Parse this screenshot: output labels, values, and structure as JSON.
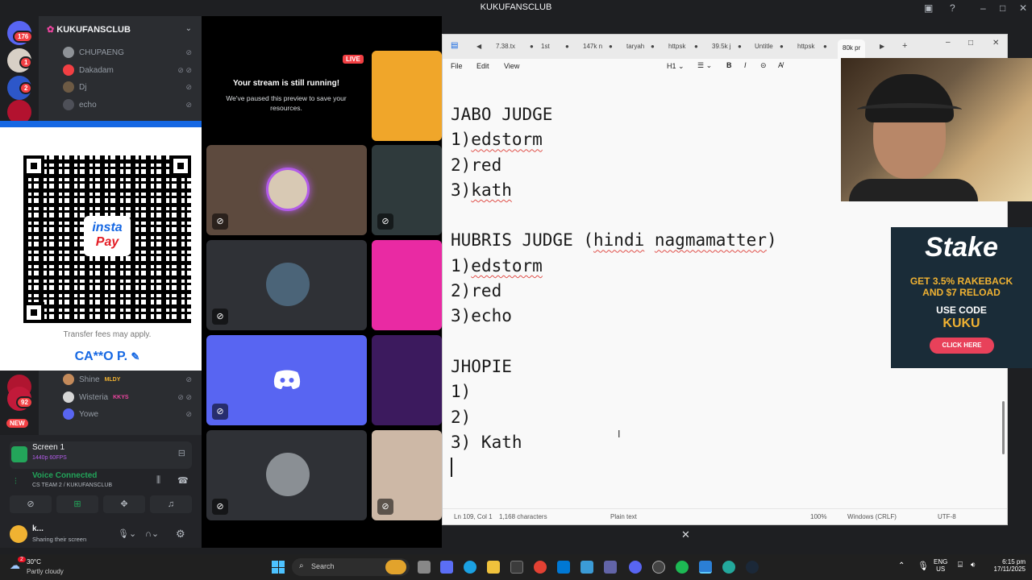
{
  "window_title": "KUKUFANSCLUB",
  "rail": {
    "badges": [
      "176",
      "1",
      "2",
      "92"
    ],
    "new_label": "NEW"
  },
  "channels": {
    "server_name": "KUKUFANSCLUB",
    "members_top": [
      "CHUPAENG",
      "Dakadam",
      "Dj",
      "echo"
    ],
    "members_bottom": [
      {
        "name": "Shine",
        "tag": "MLDY"
      },
      {
        "name": "Wisteria",
        "tag": "KKYS"
      },
      {
        "name": "Yowe",
        "tag": ""
      }
    ]
  },
  "qr_overlay": {
    "logo_top": "insta",
    "logo_bottom": "Pay",
    "fees_note": "Transfer fees may apply.",
    "account_name": "CA**O P."
  },
  "stream": {
    "live_badge": "LIVE",
    "paused_title": "Your stream is still running!",
    "paused_body": "We've paused this preview to save your resources."
  },
  "notepad": {
    "tabs": [
      "7.38.tx",
      "1st",
      "147k n",
      "taryah",
      "httpsk",
      "39.5k j",
      "Untitle",
      "httpsk"
    ],
    "active_tab": "80k pr",
    "menu": {
      "file": "File",
      "edit": "Edit",
      "view": "View",
      "heading": "H1"
    },
    "lines": {
      "l1": "JABO JUDGE",
      "l2a": "1)",
      "l2b": "edstorm",
      "l3": "2)red",
      "l4a": "3)",
      "l4b": "kath",
      "l5a": "HUBRIS JUDGE (",
      "l5b": "hindi",
      "l5c": " ",
      "l5d": "nagmamatter",
      "l5e": ")",
      "l6a": "1)",
      "l6b": "edstorm",
      "l7": "2)red",
      "l8": "3)echo",
      "l9": "JHOPIE",
      "l10": "1)",
      "l11": "2)",
      "l12": "3) Kath"
    },
    "status": {
      "position": "Ln 109, Col 1",
      "chars": "1,168 characters",
      "format": "Plain text",
      "zoom": "100%",
      "line_ending": "Windows (CRLF)",
      "encoding": "UTF-8"
    }
  },
  "stake_ad": {
    "brand": "Stake",
    "line1": "GET 3.5% RAKEBACK",
    "line2": "AND $7 RELOAD",
    "line3": "USE CODE",
    "code": "KUKU",
    "cta": "CLICK HERE"
  },
  "voice_panel": {
    "screen_title": "Screen 1",
    "screen_quality": "1440p 60FPS",
    "voice_status": "Voice Connected",
    "voice_channel": "CS TEAM 2 / KUKUFANSCLUB",
    "user_name": "k...",
    "user_status": "Sharing their screen"
  },
  "taskbar": {
    "weather_temp": "30°C",
    "weather_desc": "Partly cloudy",
    "weather_badge": "2",
    "search_placeholder": "Search",
    "lang1": "ENG",
    "lang2": "US",
    "time": "6:15 pm",
    "date": "17/11/2025"
  },
  "colors": {
    "discord_bg": "#1e1f22",
    "channel_bg": "#2b2d31",
    "blurple": "#5865f2",
    "voice_green": "#23a55a",
    "instapay_blue": "#1668e3",
    "stake_bg": "#1a2c38",
    "stake_button": "#e8415a"
  }
}
